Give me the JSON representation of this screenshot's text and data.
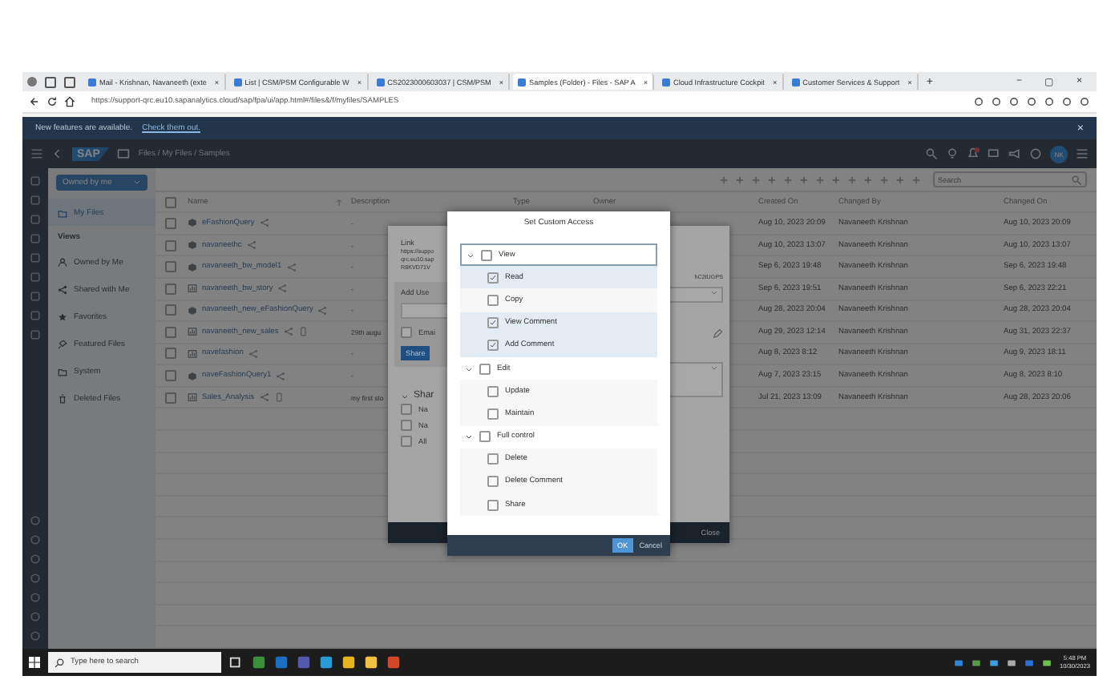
{
  "browser": {
    "tabs": [
      {
        "label": "Mail - Krishnan, Navaneeth (exte",
        "selected": false
      },
      {
        "label": "List | CSM/PSM Configurable W",
        "selected": false
      },
      {
        "label": "CS2023000603037 | CSM/PSM",
        "selected": false
      },
      {
        "label": "Samples (Folder) - Files - SAP A",
        "selected": true
      },
      {
        "label": "Cloud Infrastructure Cockpit",
        "selected": false
      },
      {
        "label": "Customer Services & Support",
        "selected": false
      }
    ],
    "new_tab": "+",
    "close_tab": "×",
    "window_controls": [
      "−",
      "▢",
      "×"
    ],
    "url": "https://support-qrc.eu10.sapanalytics.cloud/sap/fpa/ui/app.html#/files&/f/myfiles/SAMPLES"
  },
  "banner": {
    "text": "New features are available.",
    "link": "Check them out.",
    "close": "×"
  },
  "shell": {
    "logo": "SAP",
    "breadcrumb": "Files / My Files / Samples",
    "avatar": "NK"
  },
  "sidebar": {
    "filter": "Owned by me",
    "items": [
      {
        "label": "My Files",
        "kind": "folder",
        "selected": true
      },
      {
        "label": "Views",
        "kind": "header"
      },
      {
        "label": "Owned by Me",
        "kind": "person",
        "selected": false
      },
      {
        "label": "Shared with Me",
        "kind": "share",
        "selected": false
      },
      {
        "label": "Favorites",
        "kind": "star",
        "selected": false
      },
      {
        "label": "Featured Files",
        "kind": "pin",
        "selected": false
      },
      {
        "label": "System",
        "kind": "folder",
        "selected": false
      },
      {
        "label": "Deleted Files",
        "kind": "trash",
        "selected": false
      }
    ]
  },
  "search": {
    "placeholder": "Search"
  },
  "table": {
    "select_all_checked": false,
    "columns": [
      "Name",
      "Description",
      "Type",
      "Owner",
      "Created On",
      "Changed By",
      "Changed On"
    ],
    "rows": [
      {
        "checked": false,
        "name": "eFashionQuery",
        "kind": "model",
        "mobile": false,
        "description": "-",
        "created_on": "Aug 10, 2023 20:09",
        "changed_by": "Navaneeth Krishnan",
        "changed_on": "Aug 10, 2023 20:09"
      },
      {
        "checked": false,
        "name": "navaneethc",
        "kind": "model",
        "mobile": false,
        "description": "-",
        "created_on": "Aug 10, 2023 13:07",
        "changed_by": "Navaneeth Krishnan",
        "changed_on": "Aug 10, 2023 13:07"
      },
      {
        "checked": false,
        "name": "navaneeth_bw_model1",
        "kind": "model",
        "mobile": false,
        "description": "-",
        "created_on": "Sep 6, 2023 19:48",
        "changed_by": "Navaneeth Krishnan",
        "changed_on": "Sep 6, 2023 19:48"
      },
      {
        "checked": false,
        "name": "navaneeth_bw_story",
        "kind": "story",
        "mobile": false,
        "description": "-",
        "created_on": "Sep 6, 2023 19:51",
        "changed_by": "Navaneeth Krishnan",
        "changed_on": "Sep 6, 2023 22:21"
      },
      {
        "checked": false,
        "name": "navaneeth_new_eFashionQuery",
        "kind": "model",
        "mobile": false,
        "description": "-",
        "created_on": "Aug 28, 2023 20:04",
        "changed_by": "Navaneeth Krishnan",
        "changed_on": "Aug 28, 2023 20:04"
      },
      {
        "checked": false,
        "name": "navaneeth_new_sales",
        "kind": "story",
        "mobile": true,
        "description": "29th augu",
        "created_on": "Aug 29, 2023 12:14",
        "changed_by": "Navaneeth Krishnan",
        "changed_on": "Aug 31, 2023 22:37"
      },
      {
        "checked": false,
        "name": "navefashion",
        "kind": "story",
        "mobile": false,
        "description": "-",
        "created_on": "Aug 8, 2023 8:12",
        "changed_by": "Navaneeth Krishnan",
        "changed_on": "Aug 9, 2023 18:11"
      },
      {
        "checked": false,
        "name": "naveFashionQuery1",
        "kind": "model",
        "mobile": false,
        "description": "-",
        "created_on": "Aug 7, 2023 23:15",
        "changed_by": "Navaneeth Krishnan",
        "changed_on": "Aug 8, 2023 8:10"
      },
      {
        "checked": false,
        "name": "Sales_Analysis",
        "kind": "story",
        "mobile": true,
        "description": "my first sto",
        "created_on": "Jul 21, 2023 13:09",
        "changed_by": "Navaneeth Krishnan",
        "changed_on": "Aug 28, 2023 20:06"
      }
    ]
  },
  "share_dialog": {
    "link_label": "Link",
    "link_lines": [
      "https://suppo",
      "qrc.eu10.sap",
      "R8KVD71V"
    ],
    "link_tail": "hC2tUGPS",
    "add_users": "Add Use",
    "email": {
      "label": "Emai",
      "checked": false
    },
    "share_button": "Share",
    "section": "Shar",
    "list_items": [
      {
        "label": "Na",
        "checked": false
      },
      {
        "label": "Na",
        "checked": false
      },
      {
        "label": "All",
        "checked": false
      }
    ],
    "close": "Close"
  },
  "custom_access": {
    "title": "Set Custom Access",
    "groups": [
      {
        "label": "View",
        "checked": false,
        "expanded": true,
        "selected": true,
        "children": [
          {
            "label": "Read",
            "checked": true,
            "selected": true
          },
          {
            "label": "Copy",
            "checked": false,
            "selected": false
          },
          {
            "label": "View Comment",
            "checked": true,
            "selected": true
          },
          {
            "label": "Add Comment",
            "checked": true,
            "selected": true
          }
        ]
      },
      {
        "label": "Edit",
        "checked": false,
        "expanded": true,
        "selected": false,
        "children": [
          {
            "label": "Update",
            "checked": false,
            "selected": false
          },
          {
            "label": "Maintain",
            "checked": false,
            "selected": false
          }
        ]
      },
      {
        "label": "Full control",
        "checked": false,
        "expanded": true,
        "selected": false,
        "children": [
          {
            "label": "Delete",
            "checked": false,
            "selected": false
          },
          {
            "label": "Delete Comment",
            "checked": false,
            "selected": false
          },
          {
            "label": "Share",
            "checked": false,
            "selected": false
          }
        ]
      }
    ],
    "ok": "OK",
    "cancel": "Cancel"
  },
  "taskbar": {
    "search_placeholder": "Type here to search",
    "time": "5:48 PM",
    "date": "10/30/2023"
  }
}
